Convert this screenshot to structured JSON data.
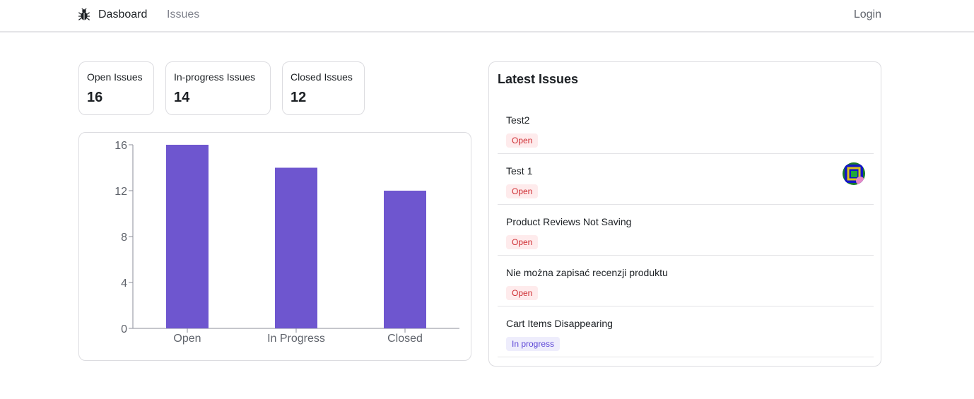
{
  "nav": {
    "logo_icon": "bug-icon",
    "dashboard_label": "Dasboard",
    "issues_label": "Issues",
    "login_label": "Login"
  },
  "stats": [
    {
      "label": "Open Issues",
      "value": "16"
    },
    {
      "label": "In-progress Issues",
      "value": "14"
    },
    {
      "label": "Closed Issues",
      "value": "12"
    }
  ],
  "chart_data": {
    "type": "bar",
    "categories": [
      "Open",
      "In Progress",
      "Closed"
    ],
    "values": [
      16,
      14,
      12
    ],
    "yticks": [
      0,
      4,
      8,
      12,
      16
    ],
    "ylim": [
      0,
      16
    ],
    "bar_color": "#6e56cf",
    "title": "",
    "xlabel": "",
    "ylabel": ""
  },
  "latest": {
    "title": "Latest Issues",
    "issues": [
      {
        "title": "Test2",
        "status": "Open",
        "status_kind": "open",
        "assignee_avatar": false
      },
      {
        "title": "Test 1",
        "status": "Open",
        "status_kind": "open",
        "assignee_avatar": true
      },
      {
        "title": "Product Reviews Not Saving",
        "status": "Open",
        "status_kind": "open",
        "assignee_avatar": false
      },
      {
        "title": "Nie można zapisać recenzji produktu",
        "status": "Open",
        "status_kind": "open",
        "assignee_avatar": false
      },
      {
        "title": "Cart Items Disappearing",
        "status": "In progress",
        "status_kind": "in-progress",
        "assignee_avatar": false
      }
    ]
  },
  "colors": {
    "accent": "#6e56cf",
    "open_badge_bg": "#feebec",
    "open_badge_text": "#ce2c31",
    "progress_badge_bg": "#eeedfc",
    "progress_badge_text": "#5b45d6"
  }
}
